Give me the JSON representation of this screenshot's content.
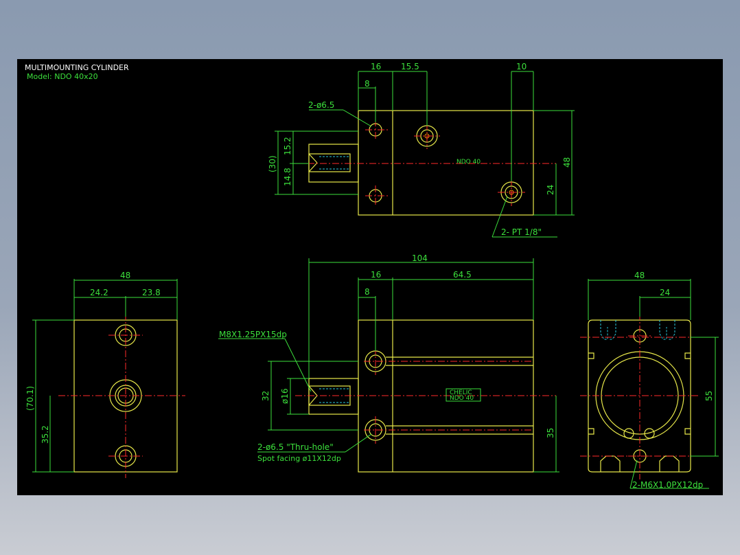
{
  "title": "MULTIMOUNTING CYLINDER",
  "model": "Model:  NDO 40x20",
  "top_view": {
    "dims": [
      "16",
      "15.5",
      "10",
      "8",
      "15.2",
      "14.8",
      "(30)",
      "48",
      "24"
    ],
    "callouts": [
      "2-ø6.5",
      "2- PT 1/8\""
    ],
    "center_mark": "NDO 40"
  },
  "side_view": {
    "dims": [
      "104",
      "16",
      "64.5",
      "8",
      "32",
      "ø16",
      "35"
    ],
    "callouts": [
      "M8X1.25PX15dp",
      "2-ø6.5 \"Thru-hole\"",
      "Spot facing  ø11X12dp"
    ],
    "label_plate": [
      "CHELIC",
      "NDO 40"
    ]
  },
  "left_view": {
    "dims": [
      "48",
      "24.2",
      "23.8",
      "(70.1)",
      "35.2"
    ]
  },
  "right_view": {
    "dims": [
      "48",
      "24",
      "55"
    ],
    "callouts": [
      "2-M6X1.0PX12dp"
    ]
  },
  "colors": {
    "outline": "#e8e84a",
    "dimension": "#3ce03c",
    "centerline": "#ff2a2a",
    "hidden": "#28c8dc",
    "background": "#000000"
  }
}
